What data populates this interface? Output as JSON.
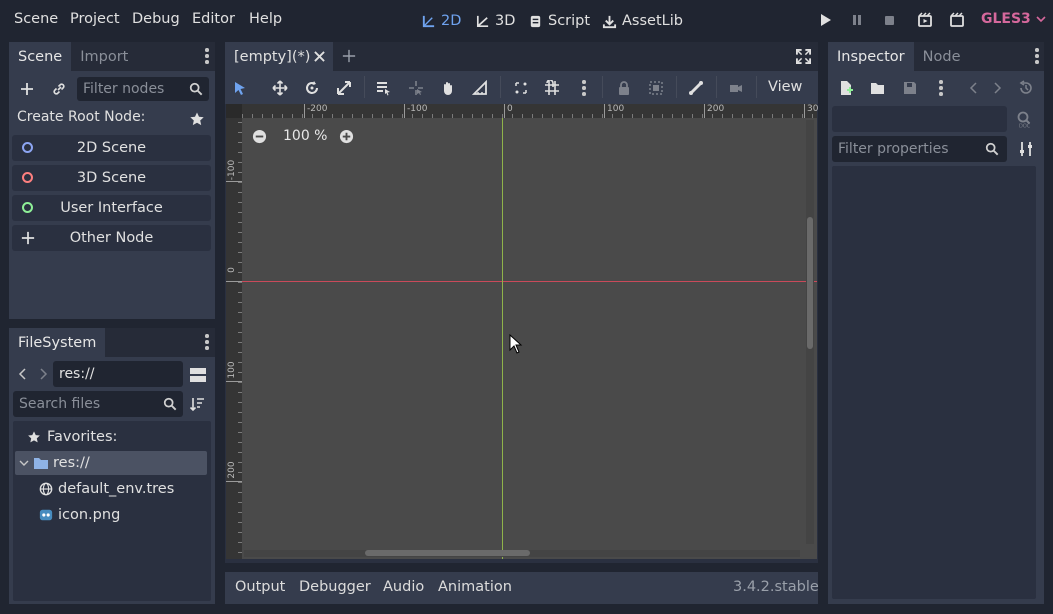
{
  "menu": {
    "scene": "Scene",
    "project": "Project",
    "debug": "Debug",
    "editor": "Editor",
    "help": "Help"
  },
  "workspaces": {
    "w2d": "2D",
    "w3d": "3D",
    "script": "Script",
    "assetlib": "AssetLib"
  },
  "renderer": "GLES3",
  "scene_dock": {
    "tab_scene": "Scene",
    "tab_import": "Import",
    "filter_placeholder": "Filter nodes",
    "create_root_label": "Create Root Node:",
    "buttons": [
      "2D Scene",
      "3D Scene",
      "User Interface",
      "Other Node"
    ]
  },
  "filesystem": {
    "tab": "FileSystem",
    "path": "res://",
    "search_placeholder": "Search files",
    "favorites": "Favorites:",
    "root": "res://",
    "files": [
      "default_env.tres",
      "icon.png"
    ]
  },
  "viewport": {
    "tab": "[empty](*)",
    "view_menu": "View",
    "zoom": "100 %",
    "hruler": [
      "-200",
      "-100",
      "0",
      "100",
      "200",
      "30"
    ],
    "vruler": [
      "-100",
      "0",
      "100",
      "200"
    ]
  },
  "bottom": {
    "output": "Output",
    "debugger": "Debugger",
    "audio": "Audio",
    "animation": "Animation",
    "version": "3.4.2.stable"
  },
  "inspector": {
    "tab_inspector": "Inspector",
    "tab_node": "Node",
    "filter_placeholder": "Filter properties"
  },
  "colors": {
    "accent": "#6fa3ef",
    "renderer": "#d5689c",
    "axis_x": "#c94a5a",
    "axis_y": "#8fb34a"
  }
}
